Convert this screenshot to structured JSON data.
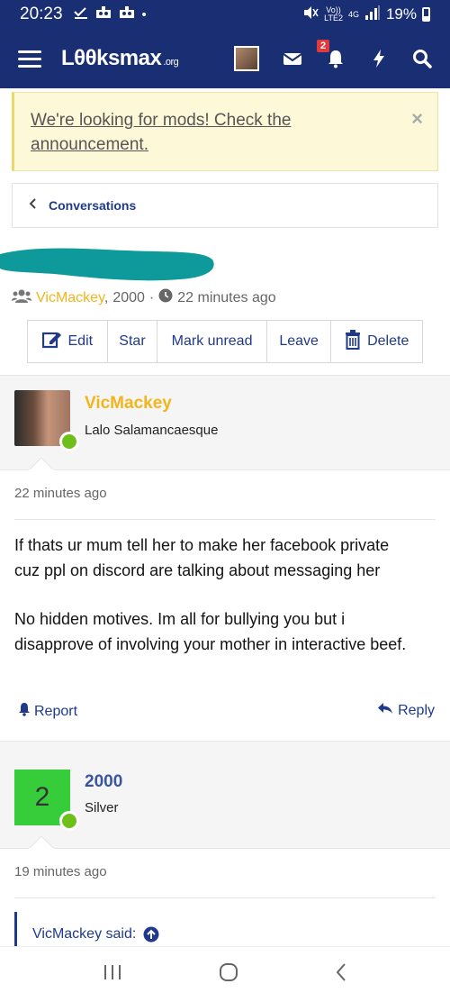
{
  "status_bar": {
    "time": "20:23",
    "battery": "19%",
    "network_top": "Vo))",
    "network_bottom": "LTE2",
    "network_type": "4G"
  },
  "header": {
    "logo": "Lθθksmax",
    "logo_suffix": ".org",
    "notification_count": "2"
  },
  "notice": {
    "text": "We're looking for mods! Check the announcement.",
    "close": "×"
  },
  "breadcrumb": {
    "label": "Conversations"
  },
  "meta": {
    "participant_1": "VicMackey",
    "separator": ",",
    "participant_2": "2000",
    "dot": "·",
    "time": "22 minutes ago"
  },
  "actions": {
    "edit": "Edit",
    "star": "Star",
    "mark_unread": "Mark unread",
    "leave": "Leave",
    "delete": "Delete"
  },
  "posts": [
    {
      "user": "VicMackey",
      "user_title": "Lalo Salamancaesque",
      "name_color": "#f2b51c",
      "time": "22 minutes ago",
      "body_1": "If thats ur mum tell her to make her facebook private cuz ppl on discord are talking about messaging her",
      "body_2": "No hidden motives. Im all for bullying you but i disapprove of involving your mother in interactive beef.",
      "report": "Report",
      "reply": "Reply"
    },
    {
      "user": "2000",
      "avatar_letter": "2",
      "user_title": "Silver",
      "name_color": "#3a55a0",
      "time": "19 minutes ago",
      "quote": "VicMackey said:"
    }
  ],
  "colors": {
    "header_bg": "#1a2e73",
    "link": "#1f3a8a",
    "notice_bg": "#fdf8d8",
    "online": "#6fbf1a",
    "scribble": "#0e9a9a"
  }
}
